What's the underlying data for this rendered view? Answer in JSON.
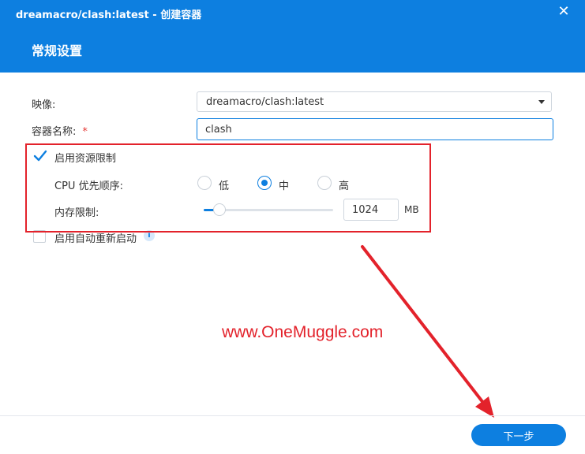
{
  "window": {
    "title": "dreamacro/clash:latest - 创建容器",
    "close_glyph": "✕",
    "section_title": "常规设置"
  },
  "form": {
    "image_label": "映像:",
    "image_value": "dreamacro/clash:latest",
    "container_name_label": "容器名称:",
    "required_mark": "*",
    "container_name_value": "clash",
    "resource_limit_label": "启用资源限制",
    "resource_limit_checked": true,
    "cpu_priority_label": "CPU 优先顺序:",
    "cpu_options": [
      "低",
      "中",
      "高"
    ],
    "cpu_selected": "中",
    "memory_limit_label": "内存限制:",
    "memory_value": "1024",
    "memory_unit": "MB",
    "memory_slider_fraction": 0.12,
    "auto_restart_label": "启用自动重新启动",
    "auto_restart_checked": false,
    "info_glyph": "i"
  },
  "watermark": "www.OneMuggle.com",
  "footer": {
    "next_label": "下一步"
  },
  "colors": {
    "accent": "#0d7fe0",
    "annotation": "#e3222b"
  }
}
